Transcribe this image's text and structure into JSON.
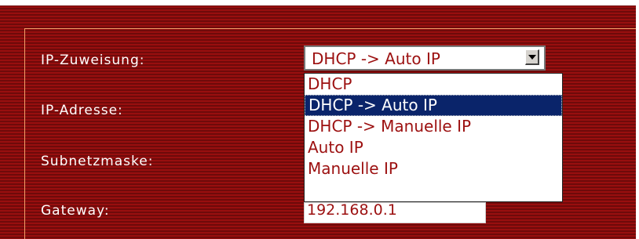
{
  "colors": {
    "background_primary": "#8b0d0d",
    "background_stripe": "#6f0a0a",
    "panel_border": "#f3a06a",
    "label_text": "#ffffff",
    "input_text": "#9c1010",
    "selected_option_background": "#0a246a",
    "selected_option_text": "#ffffff"
  },
  "form": {
    "ip_mode": {
      "label": "IP-Zuweisung:",
      "selected_value": "DHCP -> Auto IP",
      "dropdown_icon": "chevron-down-icon",
      "options": [
        "DHCP",
        "DHCP -> Auto IP",
        "DHCP -> Manuelle IP",
        "Auto IP",
        "Manuelle IP"
      ],
      "highlighted_option_index": 1
    },
    "ip_address": {
      "label": "IP-Adresse:"
    },
    "subnet_mask": {
      "label": "Subnetzmaske:"
    },
    "gateway": {
      "label": "Gateway:",
      "value": "192.168.0.1"
    }
  }
}
